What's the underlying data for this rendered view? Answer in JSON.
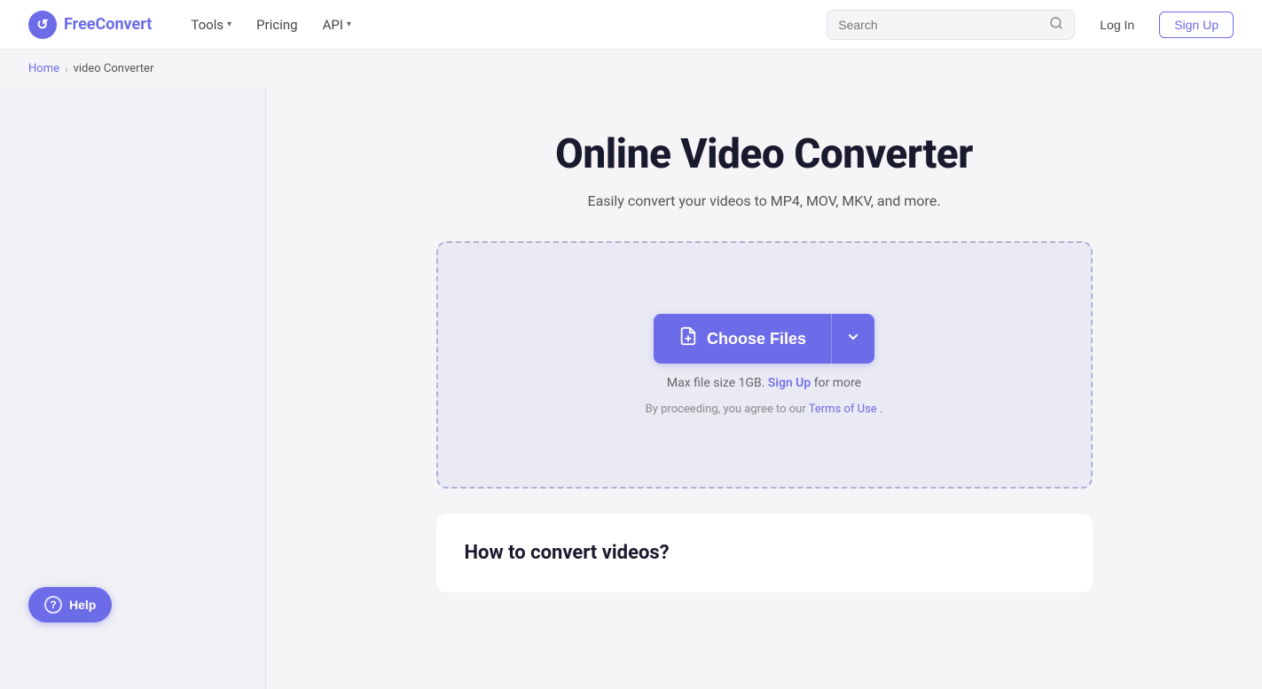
{
  "header": {
    "logo_free": "Free",
    "logo_convert": "Convert",
    "logo_icon": "↺",
    "nav": [
      {
        "label": "Tools",
        "has_dropdown": true
      },
      {
        "label": "Pricing",
        "has_dropdown": false
      },
      {
        "label": "API",
        "has_dropdown": true
      }
    ],
    "search_placeholder": "Search",
    "login_label": "Log In",
    "signup_label": "Sign Up"
  },
  "breadcrumb": {
    "home_label": "Home",
    "separator": "›",
    "current": "video Converter"
  },
  "main": {
    "page_title": "Online Video Converter",
    "page_subtitle": "Easily convert your videos to MP4, MOV, MKV, and more.",
    "drop_zone": {
      "choose_files_label": "Choose Files",
      "file_icon": "📄",
      "dropdown_icon": "⌄",
      "file_size_note": "Max file size 1GB.",
      "signup_link_label": "Sign Up",
      "file_size_suffix": " for more",
      "terms_prefix": "By proceeding, you agree to our ",
      "terms_link": "Terms of Use",
      "terms_suffix": "."
    },
    "how_to": {
      "title": "How to convert videos?"
    }
  },
  "help": {
    "label": "Help",
    "icon": "?"
  }
}
